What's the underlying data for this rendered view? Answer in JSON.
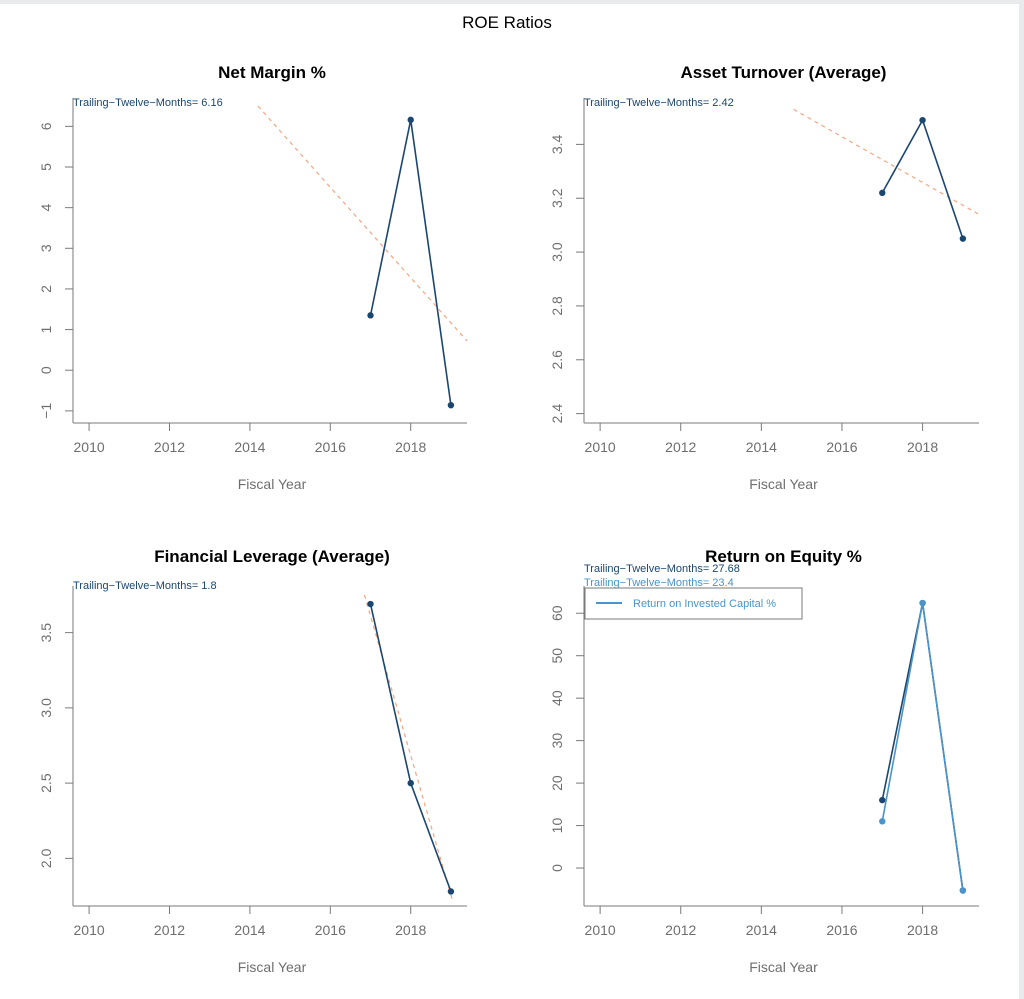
{
  "colors": {
    "primary": "#1b4670",
    "secondary": "#4a94c9",
    "trend": "#f4a582",
    "axis": "#7a7a7a",
    "text_axis": "#6e6e6e"
  },
  "chart_data": {
    "title": "ROE Ratios",
    "layout": "2x2",
    "panels": [
      {
        "id": "net-margin",
        "type": "line",
        "title": "Net Margin %",
        "xlabel": "Fiscal Year",
        "ylabel": "",
        "xlim": [
          2009.6,
          2019.4
        ],
        "ylim": [
          -1.2,
          6.55
        ],
        "xticks": [
          2010,
          2012,
          2014,
          2016,
          2018
        ],
        "yticks": [
          -1,
          0,
          1,
          2,
          3,
          4,
          5,
          6
        ],
        "ytick_labels": [
          "−1",
          "0",
          "1",
          "2",
          "3",
          "4",
          "5",
          "6"
        ],
        "annotations": [
          {
            "text": "Trailing−Twelve−Months= 6.16",
            "color": "primary"
          }
        ],
        "series": [
          {
            "name": "Net Margin %",
            "color": "primary",
            "x": [
              2017,
              2018,
              2019
            ],
            "values": [
              1.35,
              6.16,
              -0.86
            ]
          }
        ],
        "trend": {
          "x": [
            2014.2,
            2019.4
          ],
          "values": [
            6.5,
            0.72
          ]
        },
        "legend": null
      },
      {
        "id": "asset-turnover",
        "type": "line",
        "title": "Asset Turnover (Average)",
        "xlabel": "Fiscal Year",
        "ylabel": "",
        "xlim": [
          2009.6,
          2019.4
        ],
        "ylim": [
          2.38,
          3.55
        ],
        "xticks": [
          2010,
          2012,
          2014,
          2016,
          2018
        ],
        "yticks": [
          2.4,
          2.6,
          2.8,
          3.0,
          3.2,
          3.4
        ],
        "ytick_labels": [
          "2.4",
          "2.6",
          "2.8",
          "3.0",
          "3.2",
          "3.4"
        ],
        "annotations": [
          {
            "text": "Trailing−Twelve−Months= 2.42",
            "color": "primary"
          }
        ],
        "series": [
          {
            "name": "Asset Turnover (Average)",
            "color": "primary",
            "x": [
              2017,
              2018,
              2019
            ],
            "values": [
              3.22,
              3.49,
              3.05
            ]
          }
        ],
        "trend": {
          "x": [
            2014.8,
            2019.4
          ],
          "values": [
            3.53,
            3.14
          ]
        },
        "legend": null
      },
      {
        "id": "financial-leverage",
        "type": "line",
        "title": "Financial Leverage (Average)",
        "xlabel": "Fiscal Year",
        "ylabel": "",
        "xlim": [
          2009.6,
          2019.4
        ],
        "ylim": [
          1.71,
          3.77
        ],
        "xticks": [
          2010,
          2012,
          2014,
          2016,
          2018
        ],
        "yticks": [
          2.0,
          2.5,
          3.0,
          3.5
        ],
        "ytick_labels": [
          "2.0",
          "2.5",
          "3.0",
          "3.5"
        ],
        "annotations": [
          {
            "text": "Trailing−Twelve−Months= 1.8",
            "color": "primary"
          }
        ],
        "series": [
          {
            "name": "Financial Leverage (Average)",
            "color": "primary",
            "x": [
              2017,
              2018,
              2019
            ],
            "values": [
              3.69,
              2.5,
              1.78
            ]
          }
        ],
        "trend": {
          "x": [
            2016.85,
            2019.05
          ],
          "values": [
            3.75,
            1.71
          ]
        },
        "legend": null
      },
      {
        "id": "return-on-equity",
        "type": "line",
        "title": "Return on Equity %",
        "xlabel": "Fiscal Year",
        "ylabel": "",
        "xlim": [
          2009.6,
          2019.4
        ],
        "ylim": [
          -8,
          65
        ],
        "xticks": [
          2010,
          2012,
          2014,
          2016,
          2018
        ],
        "yticks": [
          0,
          10,
          20,
          30,
          40,
          50,
          60
        ],
        "ytick_labels": [
          "0",
          "10",
          "20",
          "30",
          "40",
          "50",
          "60"
        ],
        "annotations": [
          {
            "text": "Trailing−Twelve−Months= 27.68",
            "color": "primary"
          },
          {
            "text": "Trailing−Twelve−Months= 23.4",
            "color": "secondary"
          }
        ],
        "series": [
          {
            "name": "Return on Equity %",
            "color": "primary",
            "x": [
              2017,
              2018,
              2019
            ],
            "values": [
              16.0,
              62.4,
              -5.3
            ]
          },
          {
            "name": "Return on Invested Capital %",
            "color": "secondary",
            "x": [
              2017,
              2018,
              2019
            ],
            "values": [
              11.0,
              62.4,
              -5.3
            ]
          }
        ],
        "trend": null,
        "legend": {
          "placement": "top-left",
          "entries": [
            {
              "label": "Return on Invested Capital %",
              "color": "secondary"
            }
          ]
        }
      }
    ]
  }
}
